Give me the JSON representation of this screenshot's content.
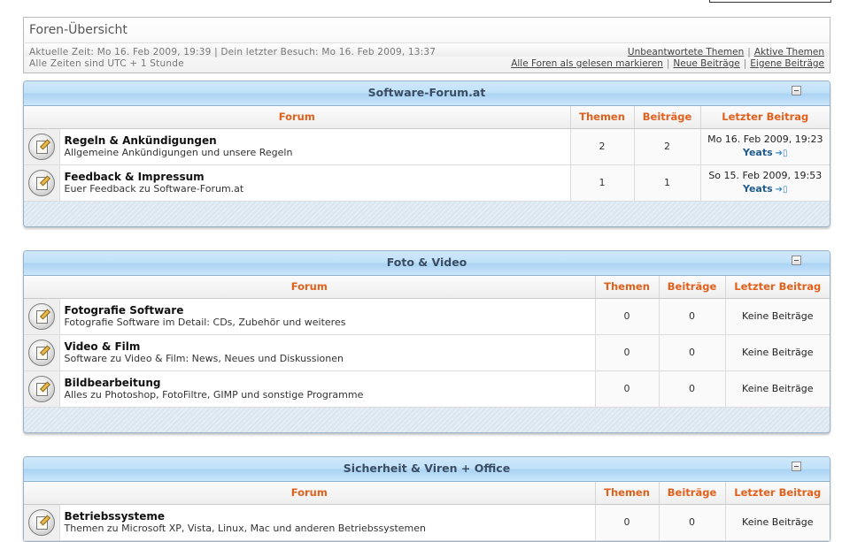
{
  "overview": {
    "title": "Foren-Übersicht",
    "current_time": "Aktuelle Zeit: Mo 16. Feb 2009, 19:39 | Dein letzter Besuch: Mo 16. Feb 2009, 13:37",
    "timezone": "Alle Zeiten sind UTC + 1 Stunde",
    "links_row1": [
      "Unbeantwortete Themen",
      "Aktive Themen"
    ],
    "links_row2": [
      "Alle Foren als gelesen markieren",
      "Neue Beiträge",
      "Eigene Beiträge"
    ]
  },
  "columns": {
    "forum": "Forum",
    "topics": "Themen",
    "posts": "Beiträge",
    "last": "Letzter Beitrag"
  },
  "categories": [
    {
      "title": "Software-Forum.at",
      "forums": [
        {
          "name": "Regeln & Ankündigungen",
          "desc": "Allgemeine Ankündigungen und unsere Regeln",
          "topics": "2",
          "posts": "2",
          "last_date": "Mo 16. Feb 2009, 19:23",
          "last_user": "Yeats",
          "goto": "➔▯"
        },
        {
          "name": "Feedback & Impressum",
          "desc": "Euer Feedback zu Software-Forum.at",
          "topics": "1",
          "posts": "1",
          "last_date": "So 15. Feb 2009, 19:53",
          "last_user": "Yeats",
          "goto": "➔▯"
        }
      ]
    },
    {
      "title": "Foto & Video",
      "forums": [
        {
          "name": "Fotografie Software",
          "desc": "Fotografie Software im Detail: CDs, Zubehör und weiteres",
          "topics": "0",
          "posts": "0",
          "last_text": "Keine Beiträge"
        },
        {
          "name": "Video & Film",
          "desc": "Software zu Video & Film: News, Neues und Diskussionen",
          "topics": "0",
          "posts": "0",
          "last_text": "Keine Beiträge"
        },
        {
          "name": "Bildbearbeitung",
          "desc": "Alles zu Photoshop, FotoFiltre, GIMP und sonstige Programme",
          "topics": "0",
          "posts": "0",
          "last_text": "Keine Beiträge"
        }
      ]
    },
    {
      "title": "Sicherheit & Viren + Office",
      "forums": [
        {
          "name": "Betriebssysteme",
          "desc": "Themen zu Microsoft XP, Vista, Linux, Mac und anderen Betriebssystemen",
          "topics": "0",
          "posts": "0",
          "last_text": "Keine Beiträge"
        }
      ]
    }
  ],
  "colors": {
    "header_text": "#e0601c",
    "category_bar": "#bfe0f8",
    "username": "#1e5a8c"
  }
}
